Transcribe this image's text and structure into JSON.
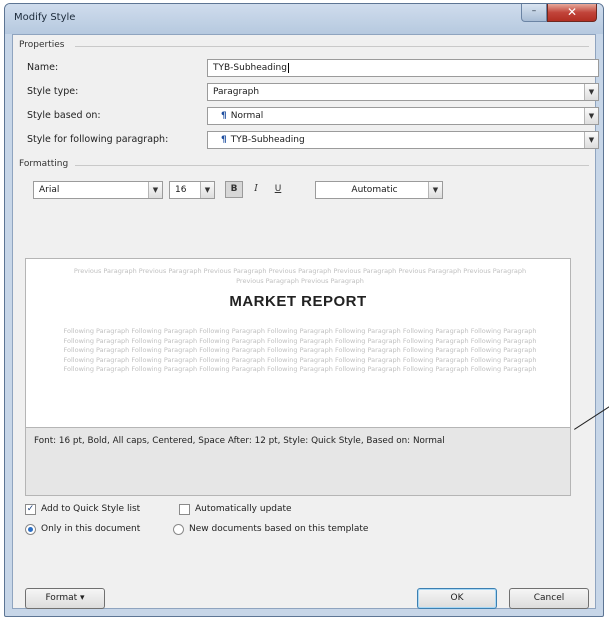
{
  "window": {
    "title": "Modify Style",
    "minimize_glyph": "–",
    "close_glyph": "✕"
  },
  "properties": {
    "section_label": "Properties",
    "name_label": "Name:",
    "name_value": "TYB-Subheading",
    "style_type_label": "Style type:",
    "style_type_value": "Paragraph",
    "based_on_label": "Style based on:",
    "based_on_value": "Normal",
    "following_label": "Style for following paragraph:",
    "following_value": "TYB-Subheading",
    "para_glyph": "¶"
  },
  "formatting": {
    "section_label": "Formatting",
    "font_value": "Arial",
    "size_value": "16",
    "bold_label": "B",
    "italic_label": "I",
    "underline_label": "U",
    "color_value": "Automatic"
  },
  "preview": {
    "previous_text": "Previous Paragraph Previous Paragraph Previous Paragraph Previous Paragraph Previous Paragraph Previous Paragraph Previous Paragraph Previous Paragraph Previous Paragraph",
    "heading": "MARKET REPORT",
    "following_text": "Following Paragraph Following Paragraph Following Paragraph Following Paragraph Following Paragraph Following Paragraph Following Paragraph Following Paragraph Following Paragraph Following Paragraph Following Paragraph Following Paragraph Following Paragraph Following Paragraph Following Paragraph Following Paragraph Following Paragraph Following Paragraph Following Paragraph Following Paragraph Following Paragraph Following Paragraph Following Paragraph Following Paragraph Following Paragraph Following Paragraph Following Paragraph Following Paragraph Following Paragraph Following Paragraph Following Paragraph Following Paragraph Following Paragraph Following Paragraph Following Paragraph",
    "description": "Font: 16 pt, Bold, All caps, Centered, Space After:  12 pt, Style: Quick Style, Based on: Normal"
  },
  "options": {
    "add_quick_style": "Add to Quick Style list",
    "auto_update": "Automatically update",
    "only_this_doc": "Only in this document",
    "new_docs": "New documents based on this template",
    "add_quick_style_checked": true,
    "auto_update_checked": false
  },
  "buttons": {
    "format": "Format ▾",
    "ok": "OK",
    "cancel": "Cancel"
  },
  "colors": {
    "accent": "#2d6fc4",
    "chrome": "#c7d6e8",
    "close": "#c1443a"
  }
}
